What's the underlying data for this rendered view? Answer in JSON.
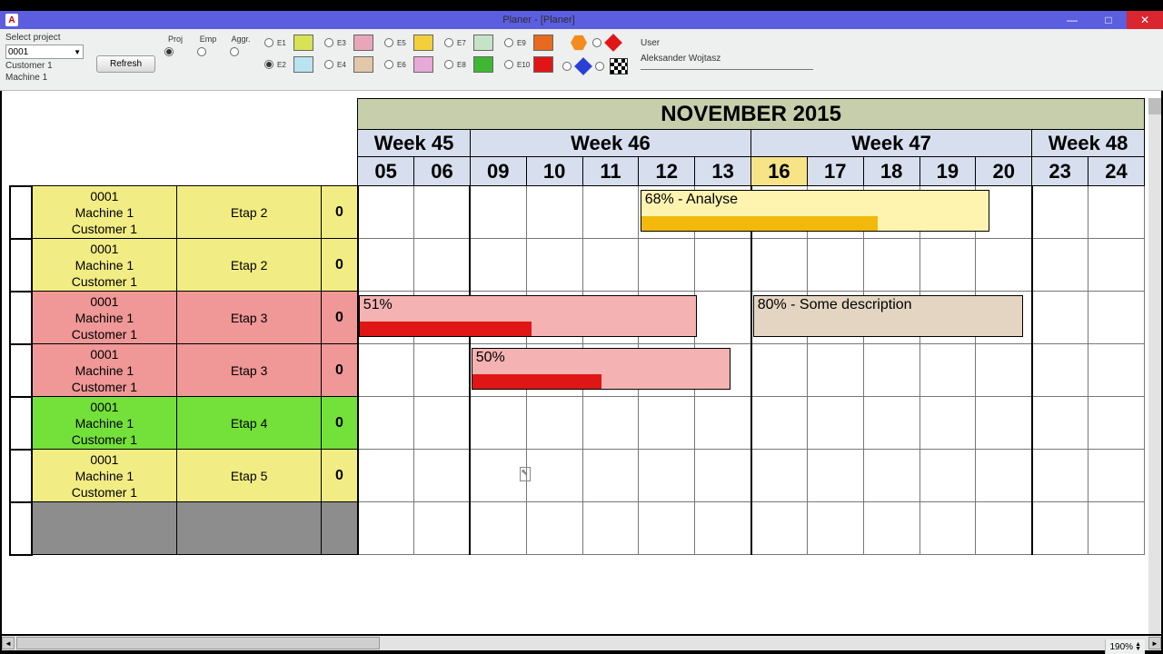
{
  "window": {
    "app_letter": "A",
    "title": "Planer - [Planer]"
  },
  "toolbar": {
    "select_project_label": "Select project",
    "project_id": "0001",
    "customer": "Customer 1",
    "machine": "Machine 1",
    "refresh": "Refresh",
    "filter_heads": [
      "Proj",
      "Emp",
      "Aggr."
    ],
    "legend": {
      "E1": "#d7e255",
      "E2": "#b9e4ef",
      "E3": "#e9a6bb",
      "E4": "#e3c7a9",
      "E5": "#f4cf3c",
      "E6": "#e7a9d7",
      "E7": "#c7e3c7",
      "E8": "#3fb733",
      "E9": "#e86a1f",
      "E10": "#e01616"
    },
    "shapes": {
      "diamond1": "#e01616",
      "diamond2": "#2a3fd6"
    },
    "user_label": "User",
    "user_name": "Aleksander Wojtasz"
  },
  "timeline": {
    "month": "NOVEMBER 2015",
    "weeks": [
      {
        "label": "Week 45",
        "days": [
          "05",
          "06"
        ]
      },
      {
        "label": "Week 46",
        "days": [
          "09",
          "10",
          "11",
          "12",
          "13"
        ]
      },
      {
        "label": "Week 47",
        "days": [
          "16",
          "17",
          "18",
          "19",
          "20"
        ]
      },
      {
        "label": "Week 48",
        "days": [
          "23",
          "24"
        ]
      }
    ],
    "today": "16"
  },
  "rows": [
    {
      "color": "yellow",
      "id": "0001",
      "machine": "Machine 1",
      "customer": "Customer 1",
      "stage": "Etap 2",
      "zero": "0",
      "tasks": [
        {
          "label": "68% - Analyse",
          "bg": "#fff3b0",
          "prog_color": "#f2b90c",
          "start": 5,
          "span": 6.2,
          "progress": 0.68,
          "prog_span": 4.2
        }
      ]
    },
    {
      "color": "yellow",
      "id": "0001",
      "machine": "Machine 1",
      "customer": "Customer 1",
      "stage": "Etap 2",
      "zero": "0",
      "tasks": []
    },
    {
      "color": "pink",
      "id": "0001",
      "machine": "Machine 1",
      "customer": "Customer 1",
      "stage": "Etap 3",
      "zero": "0",
      "tasks": [
        {
          "label": "51%",
          "bg": "#f4b2b2",
          "prog_color": "#e01616",
          "start": 0,
          "span": 6.0,
          "progress": 0.51,
          "prog_span": 3.05
        },
        {
          "label": "80% - Some description",
          "bg": "#e3d5c2",
          "prog_color": "#e3d5c2",
          "start": 7,
          "span": 4.8,
          "progress": 0,
          "prog_span": 0
        }
      ]
    },
    {
      "color": "pink",
      "id": "0001",
      "machine": "Machine 1",
      "customer": "Customer 1",
      "stage": "Etap 3",
      "zero": "0",
      "tasks": [
        {
          "label": "50%",
          "bg": "#f4b2b2",
          "prog_color": "#e01616",
          "start": 2,
          "span": 4.6,
          "progress": 0.5,
          "prog_span": 2.3
        }
      ]
    },
    {
      "color": "green",
      "id": "0001",
      "machine": "Machine 1",
      "customer": "Customer 1",
      "stage": "Etap 4",
      "zero": "0",
      "tasks": []
    },
    {
      "color": "yellow",
      "id": "0001",
      "machine": "Machine 1",
      "customer": "Customer 1",
      "stage": "Etap 5",
      "zero": "0",
      "tasks": []
    }
  ],
  "zoom": "190%"
}
